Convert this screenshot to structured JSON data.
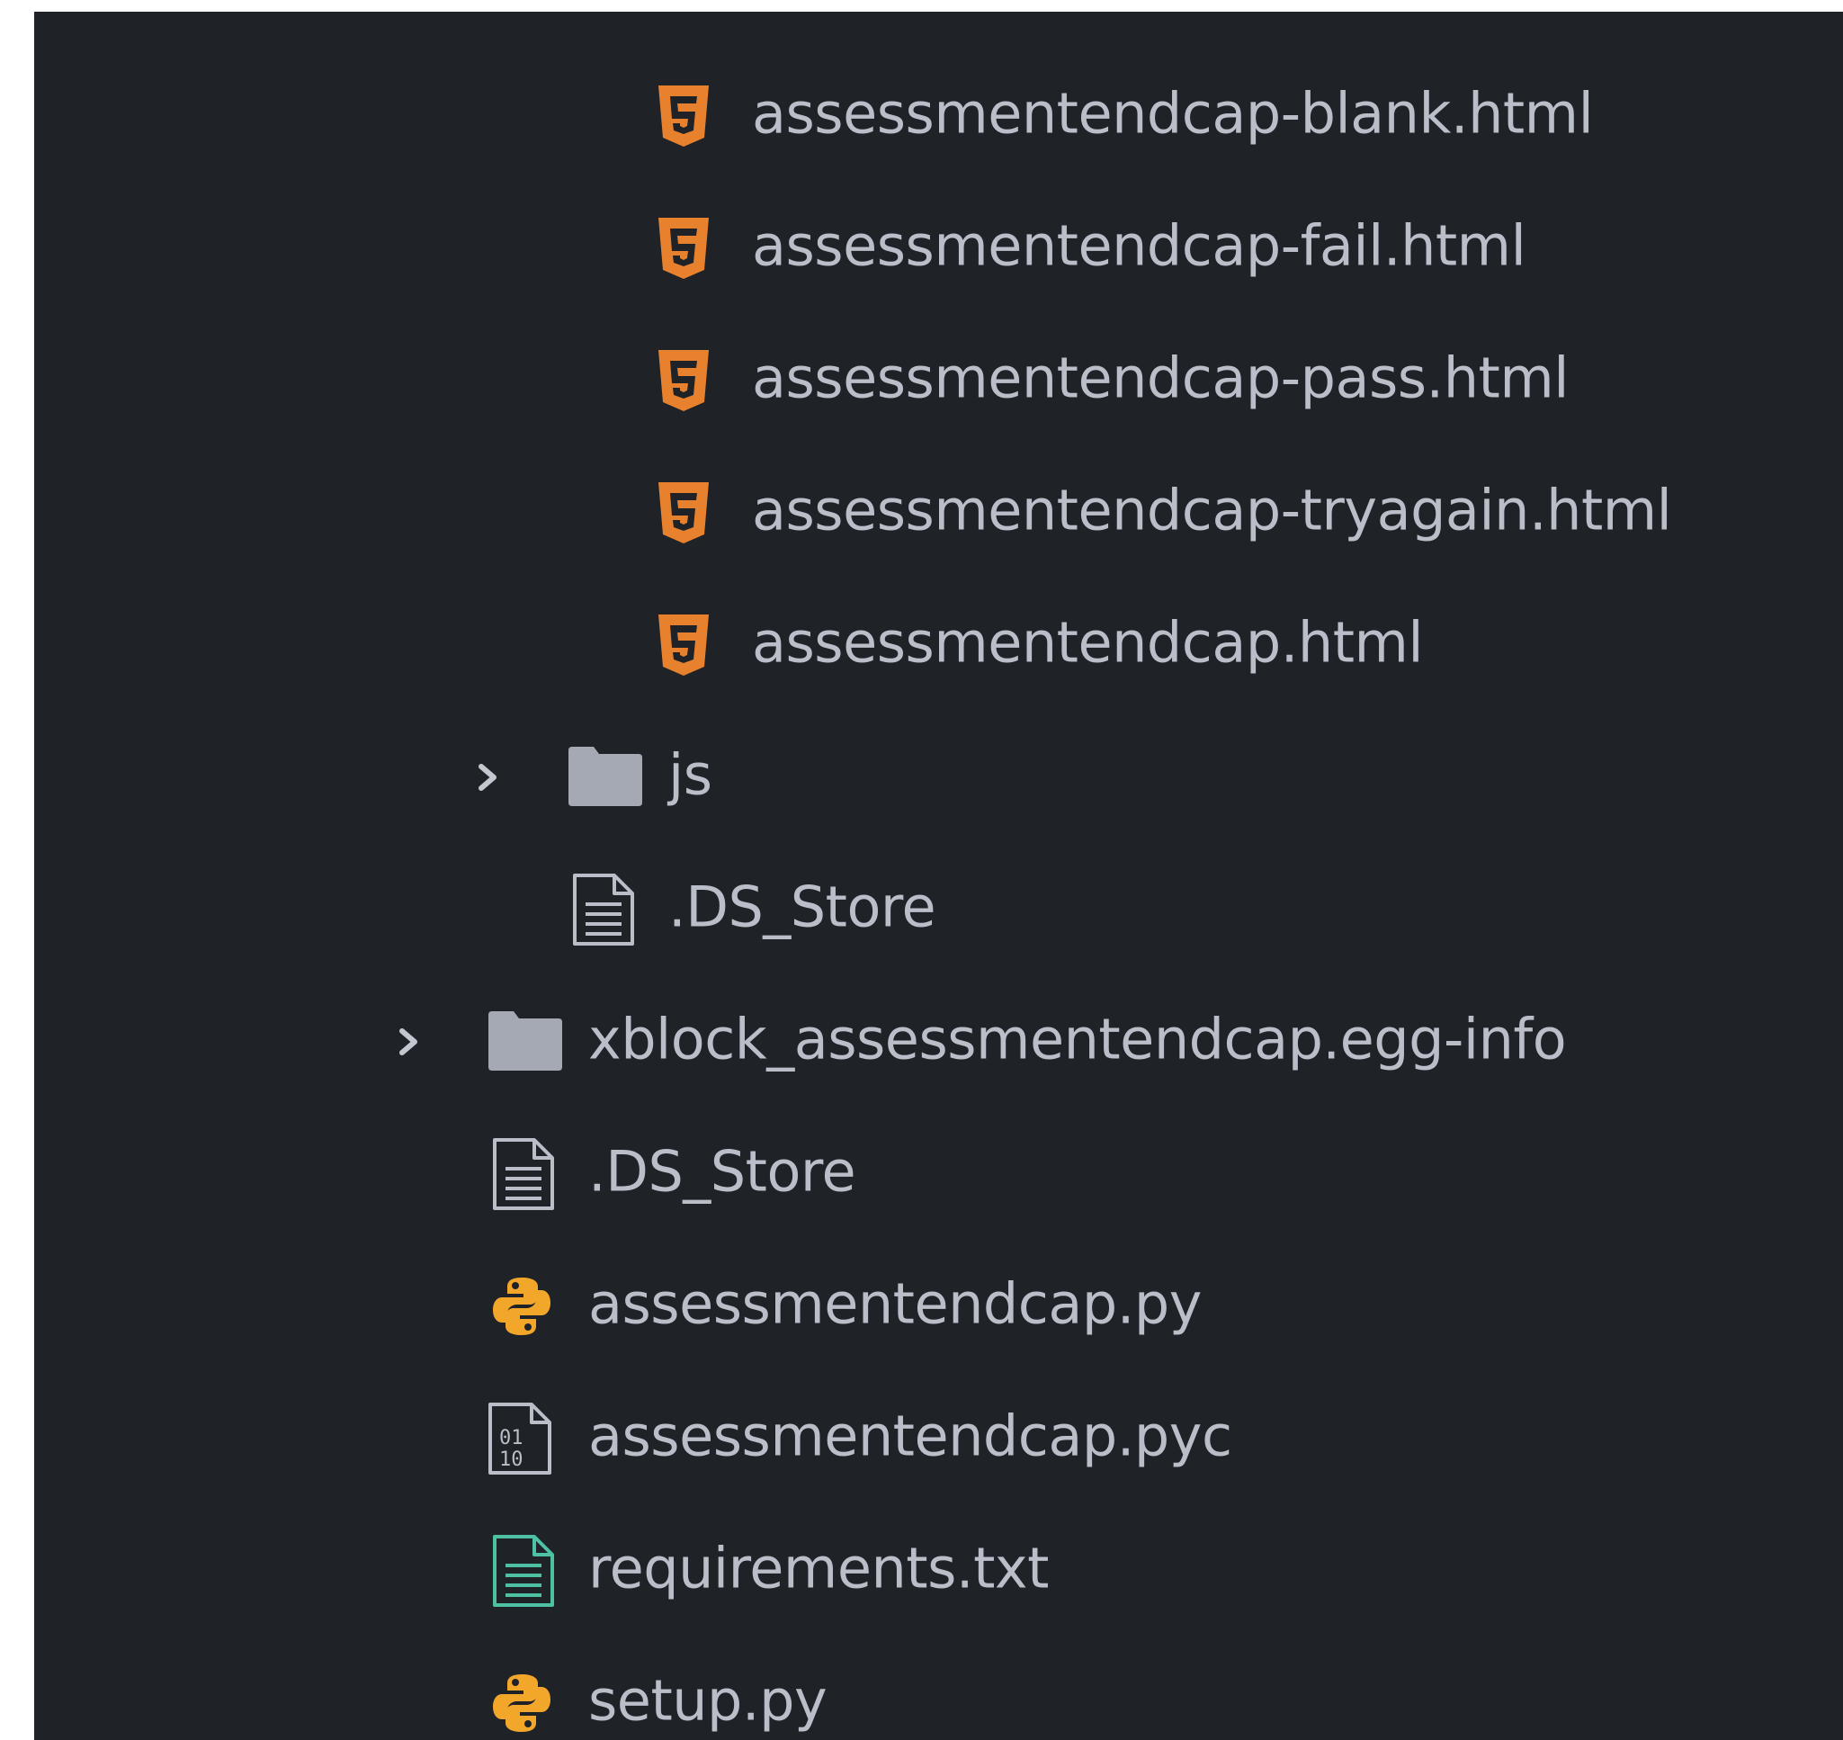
{
  "file_tree": {
    "items": [
      {
        "name": "assessmentendcap-blank.html",
        "icon": "html5-icon"
      },
      {
        "name": "assessmentendcap-fail.html",
        "icon": "html5-icon"
      },
      {
        "name": "assessmentendcap-pass.html",
        "icon": "html5-icon"
      },
      {
        "name": "assessmentendcap-tryagain.html",
        "icon": "html5-icon"
      },
      {
        "name": "assessmentendcap.html",
        "icon": "html5-icon"
      },
      {
        "name": "js",
        "icon": "folder-icon",
        "expandable": true,
        "expanded": false
      },
      {
        "name": ".DS_Store",
        "icon": "file-text-icon"
      },
      {
        "name": "xblock_assessmentendcap.egg-info",
        "icon": "folder-icon",
        "expandable": true,
        "expanded": false
      },
      {
        "name": ".DS_Store",
        "icon": "file-text-icon"
      },
      {
        "name": "assessmentendcap.py",
        "icon": "python-icon"
      },
      {
        "name": "assessmentendcap.pyc",
        "icon": "binary-file-icon"
      },
      {
        "name": "requirements.txt",
        "icon": "file-text-icon"
      },
      {
        "name": "setup.py",
        "icon": "python-icon"
      }
    ]
  },
  "colors": {
    "background": "#1f2227",
    "text": "#b9bec8",
    "html_icon": "#e8812e",
    "python_icon": "#f2a72a",
    "folder_icon": "#a4a9b4",
    "requirements_icon": "#4ec1a5"
  }
}
